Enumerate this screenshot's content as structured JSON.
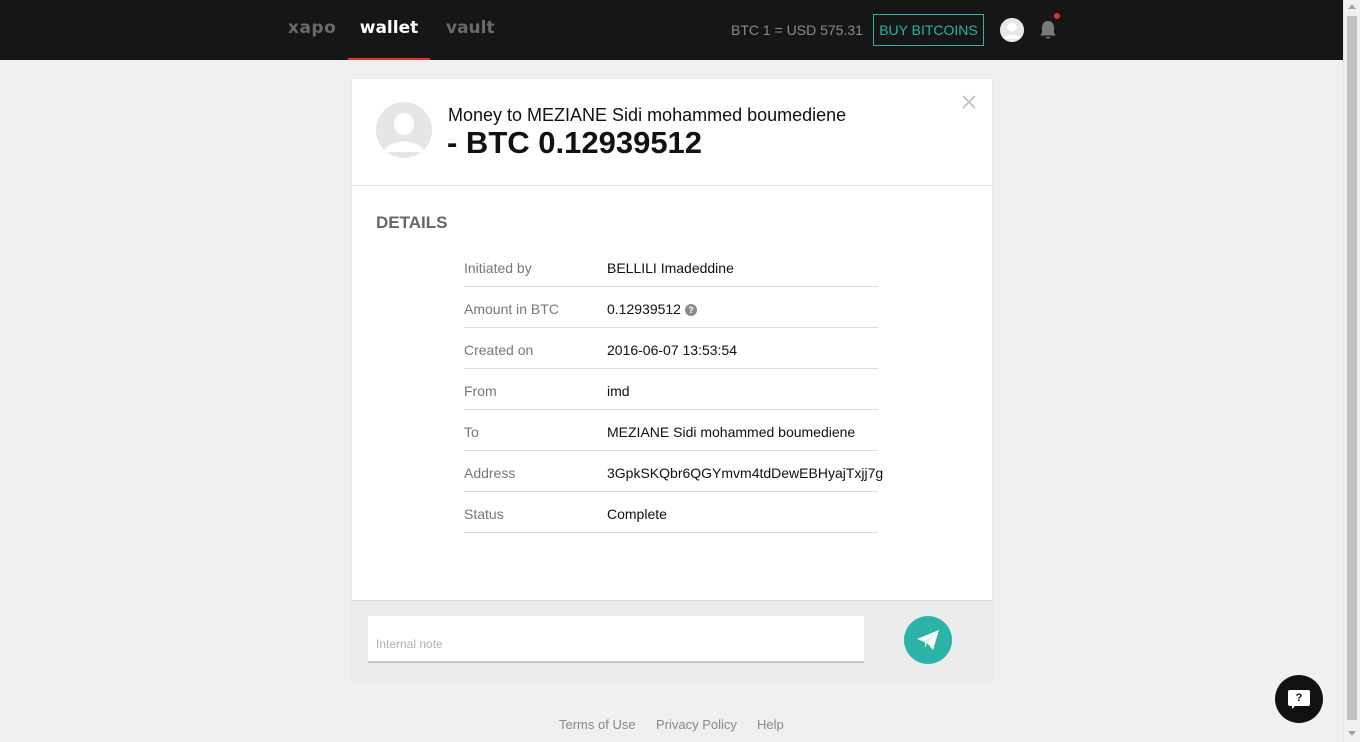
{
  "nav": {
    "brand": "xapo",
    "wallet": "wallet",
    "vault": "vault",
    "rate": "BTC 1 = USD 575.31",
    "buy_label": "BUY BITCOINS",
    "accent_color": "#2bb3a6",
    "active_underline_color": "#e8312f"
  },
  "transaction": {
    "title": "Money to MEZIANE Sidi mohammed boumediene",
    "amount": "- BTC 0.12939512"
  },
  "details": {
    "heading": "DETAILS",
    "rows": [
      {
        "label": "Initiated by",
        "value": "BELLILI Imadeddine"
      },
      {
        "label": "Amount in BTC",
        "value": "0.12939512",
        "help": "?"
      },
      {
        "label": "Created on",
        "value": "2016-06-07 13:53:54"
      },
      {
        "label": "From",
        "value": "imd"
      },
      {
        "label": "To",
        "value": "MEZIANE Sidi mohammed boumediene"
      },
      {
        "label": "Address",
        "value": "3GpkSKQbr6QGYmvm4tdDewEBHyajTxjj7g"
      },
      {
        "label": "Status",
        "value": "Complete"
      }
    ]
  },
  "note": {
    "placeholder": "Internal note"
  },
  "footer": {
    "terms": "Terms of Use",
    "privacy": "Privacy Policy",
    "help": "Help"
  },
  "chat": {
    "label": "?"
  }
}
